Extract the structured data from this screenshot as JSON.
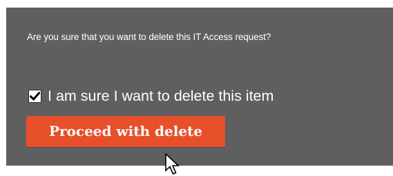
{
  "dialog": {
    "question": "Are you sure that you want to delete this IT Access request?",
    "confirm_checkbox": {
      "label": "I am sure I want to delete this item",
      "checked": true
    },
    "proceed_button_label": "Proceed with delete"
  },
  "colors": {
    "panel_background": "#5f5f5f",
    "button_background": "#e84f2b",
    "text": "#ffffff"
  },
  "icons": {
    "checkmark": "checkmark-icon",
    "cursor": "mouse-pointer-icon"
  }
}
